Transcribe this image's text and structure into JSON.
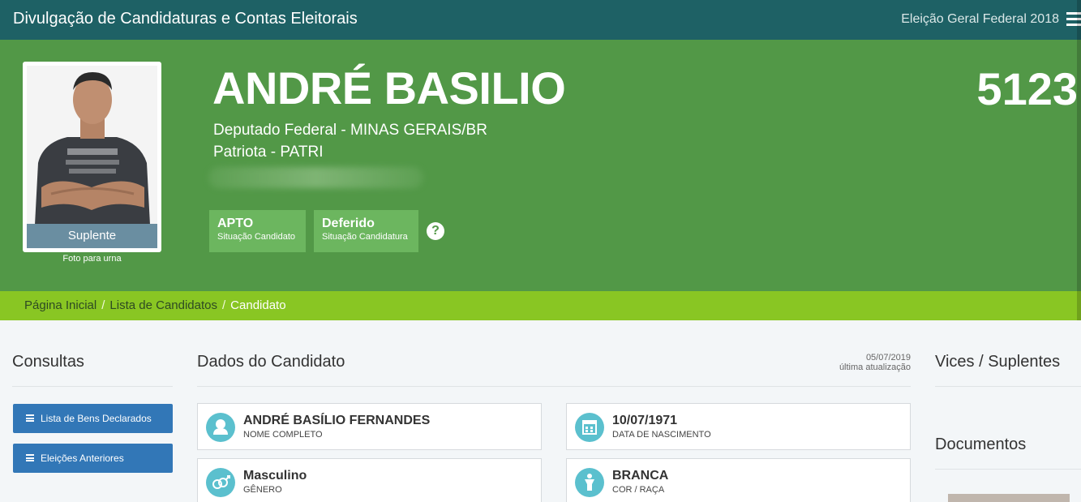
{
  "topbar": {
    "title": "Divulgação de Candidaturas e Contas Eleitorais",
    "election": "Eleição Geral Federal 2018",
    "menu_icon": "hamburger-icon"
  },
  "candidate": {
    "name": "ANDRÉ BASILIO",
    "office": "Deputado Federal - MINAS GERAIS/BR",
    "party": "Patriota - PATRI",
    "number": "5123",
    "photo_label": "Suplente",
    "photo_caption": "Foto para urna",
    "status": {
      "value": "APTO",
      "label": "Situação Candidato"
    },
    "candidacy": {
      "value": "Deferido",
      "label": "Situação Candidatura"
    },
    "help_icon": "question-circle-icon"
  },
  "breadcrumb": {
    "items": [
      "Página Inicial",
      "Lista de Candidatos"
    ],
    "current": "Candidato",
    "separator": "/"
  },
  "sidebar": {
    "title": "Consultas",
    "buttons": [
      "Lista de Bens Declarados",
      "Eleições Anteriores"
    ]
  },
  "main": {
    "title": "Dados do Candidato",
    "updated_date": "05/07/2019",
    "updated_label": "última atualização",
    "cards": [
      {
        "value": "ANDRÉ BASÍLIO FERNANDES",
        "label": "NOME COMPLETO",
        "icon": "user-icon"
      },
      {
        "value": "10/07/1971",
        "label": "DATA DE NASCIMENTO",
        "icon": "calendar-icon"
      },
      {
        "value": "Masculino",
        "label": "GÊNERO",
        "icon": "gender-icon"
      },
      {
        "value": "BRANCA",
        "label": "COR / RAÇA",
        "icon": "person-icon"
      }
    ]
  },
  "right": {
    "vices_title": "Vices / Suplentes",
    "documents_title": "Documentos"
  },
  "colors": {
    "topbar": "#1e6165",
    "hero": "#529847",
    "badge": "#6cb65f",
    "breadcrumb": "#89c623",
    "button": "#3277b7",
    "icon_circle": "#5bc0ce"
  }
}
